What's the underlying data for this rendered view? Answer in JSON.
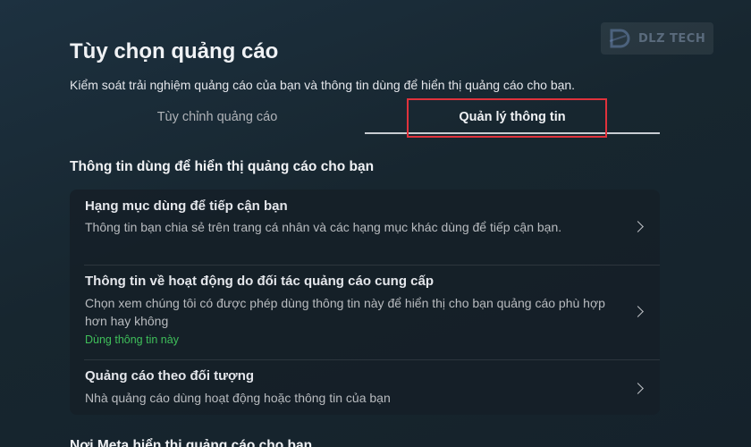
{
  "watermark": {
    "text": "DLZ TECH"
  },
  "header": {
    "title": "Tùy chọn quảng cáo",
    "subtitle": "Kiểm soát trải nghiệm quảng cáo của bạn và thông tin dùng để hiển thị quảng cáo cho bạn."
  },
  "tabs": [
    {
      "label": "Tùy chỉnh quảng cáo",
      "selected": false
    },
    {
      "label": "Quản lý thông tin",
      "selected": true
    }
  ],
  "section": {
    "heading": "Thông tin dùng để hiển thị quảng cáo cho bạn",
    "items": [
      {
        "title": "Hạng mục dùng để tiếp cận bạn",
        "description": "Thông tin bạn chia sẻ trên trang cá nhân và các hạng mục khác dùng để tiếp cận bạn."
      },
      {
        "title": "Thông tin về hoạt động do đối tác quảng cáo cung cấp",
        "description": "Chọn xem chúng tôi có được phép dùng thông tin này để hiển thị cho bạn quảng cáo phù hợp hơn hay không",
        "status": "Dùng thông tin này"
      },
      {
        "title": "Quảng cáo theo đối tượng",
        "description": "Nhà quảng cáo dùng hoạt động hoặc thông tin của bạn"
      }
    ]
  },
  "next_section": {
    "heading": "Nơi Meta hiển thị quảng cáo cho bạn"
  },
  "colors": {
    "highlight": "#e0323c",
    "status_green": "#3fbf5a",
    "background": "#1a2b36"
  },
  "icons": {
    "chevron": "chevron-right-icon"
  }
}
